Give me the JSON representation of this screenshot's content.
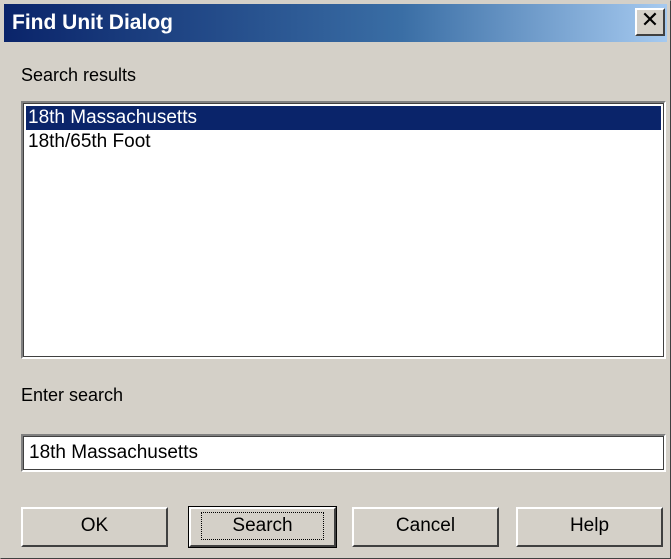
{
  "window": {
    "title": "Find Unit Dialog",
    "close_symbol": "✕"
  },
  "results": {
    "label": "Search results",
    "items": [
      {
        "text": "18th Massachusetts",
        "selected": true
      },
      {
        "text": "18th/65th Foot",
        "selected": false
      }
    ]
  },
  "search": {
    "label": "Enter search",
    "value": "18th Massachusetts"
  },
  "buttons": {
    "ok": "OK",
    "search": "Search",
    "cancel": "Cancel",
    "help": "Help"
  },
  "colors": {
    "title_bar": "#0a246a",
    "selection": "#0a246a",
    "face": "#d4d0c8"
  }
}
